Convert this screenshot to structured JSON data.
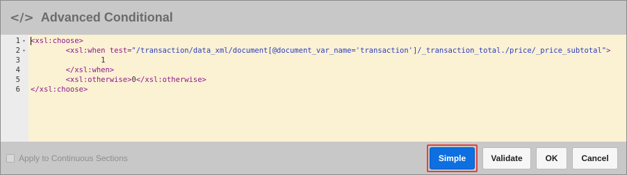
{
  "dialog": {
    "title_icon": "</>",
    "title": "Advanced Conditional"
  },
  "editor": {
    "lines": [
      {
        "num": "1",
        "fold": "▾"
      },
      {
        "num": "2",
        "fold": "▾"
      },
      {
        "num": "3",
        "fold": ""
      },
      {
        "num": "4",
        "fold": ""
      },
      {
        "num": "5",
        "fold": ""
      },
      {
        "num": "6",
        "fold": ""
      }
    ],
    "code": {
      "l1": "<xsl:choose>",
      "l2_open": "<xsl:when ",
      "l2_attr": "test=",
      "l2_str": "\"/transaction/data_xml/document[@document_var_name='transaction']/_transaction_total./price/_price_subtotal\"",
      "l2_close": ">",
      "l3": "1",
      "l4": "</xsl:when>",
      "l5_open": "<xsl:otherwise>",
      "l5_text": "0",
      "l5_close": "</xsl:otherwise>",
      "l6": "</xsl:choose>"
    }
  },
  "footer": {
    "checkbox_label": "Apply to Continuous Sections",
    "checkbox_checked": false,
    "buttons": {
      "simple": "Simple",
      "validate": "Validate",
      "ok": "OK",
      "cancel": "Cancel"
    }
  },
  "colors": {
    "primary": "#0d6fe0",
    "highlight": "#e0413e",
    "editor_bg": "#fbf1d3",
    "tag": "#8b1b8b",
    "string": "#2a3fbf"
  }
}
